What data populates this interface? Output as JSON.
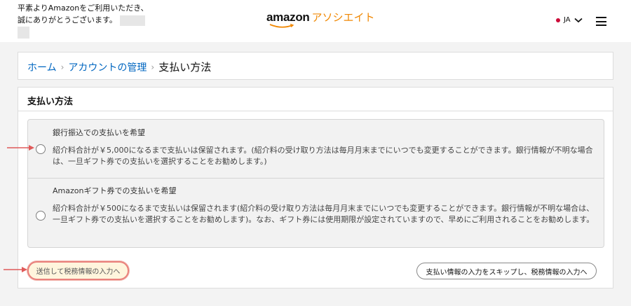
{
  "header": {
    "greeting_line1": "平素よりAmazonをご利用いただき、",
    "greeting_line2": "誠にありがとうございます。",
    "logo_main": "amazon",
    "logo_sub": "アソシエイト",
    "language": "JA",
    "icons": [
      "language-flag-dot",
      "chevron-down-icon",
      "hamburger-menu-icon"
    ]
  },
  "breadcrumb": {
    "home": "ホーム",
    "account": "アカウントの管理",
    "current": "支払い方法",
    "separator": "›"
  },
  "payment": {
    "section_title": "支払い方法",
    "options": [
      {
        "title": "銀行振込での支払いを希望",
        "description": "紹介料合計が￥5,000になるまで支払いは保留されます。(紹介料の受け取り方法は毎月月末までにいつでも変更することができます。銀行情報が不明な場合は、一旦ギフト券での支払いを選択することをお勧めします。)",
        "selected": false
      },
      {
        "title": "Amazonギフト券での支払いを希望",
        "description": "紹介料合計が￥500になるまで支払いは保留されます(紹介料の受け取り方法は毎月月末までにいつでも変更することができます。銀行情報が不明な場合は、一旦ギフト券での支払いを選択することをお勧めします)。なお、ギフト券には使用期限が設定されていますので、早めにご利用されることをお勧めします。",
        "selected": false
      }
    ],
    "submit_label": "送信して税務情報の入力へ",
    "skip_label": "支払い情報の入力をスキップし、税務情報の入力へ"
  },
  "colors": {
    "link": "#0066c0",
    "brand_orange": "#f08804",
    "annotation_arrow": "#e05a5a",
    "submit_highlight": "#e9817c"
  }
}
